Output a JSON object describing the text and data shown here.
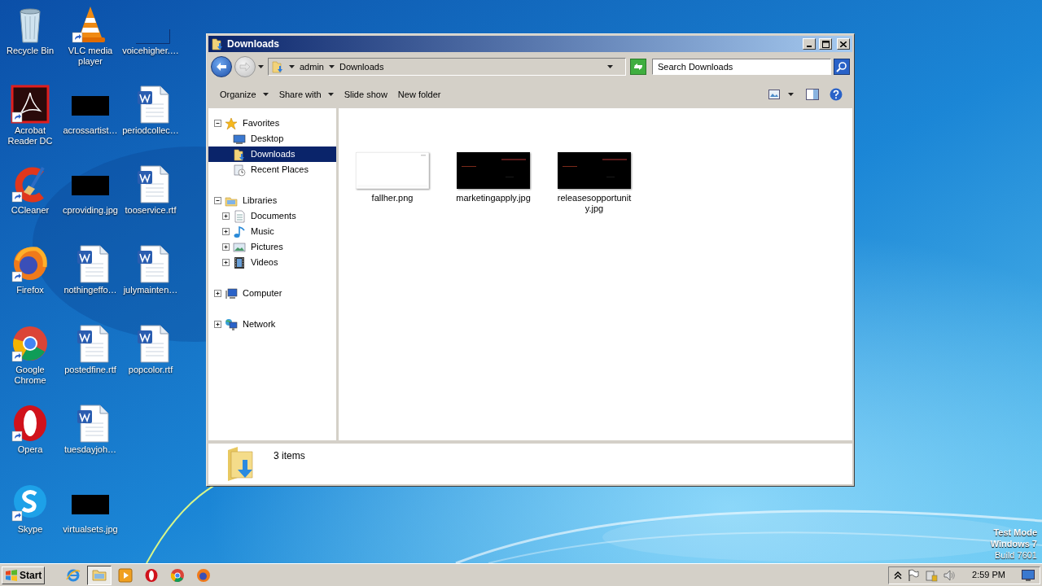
{
  "desktop": {
    "columns": [
      [
        {
          "label": "Recycle Bin",
          "kind": "recycle-bin",
          "shortcut": false
        },
        {
          "label": "Acrobat Reader DC",
          "kind": "acrobat",
          "shortcut": true
        },
        {
          "label": "CCleaner",
          "kind": "ccleaner",
          "shortcut": true
        },
        {
          "label": "Firefox",
          "kind": "firefox",
          "shortcut": true
        },
        {
          "label": "Google Chrome",
          "kind": "chrome",
          "shortcut": true
        },
        {
          "label": "Opera",
          "kind": "opera",
          "shortcut": true
        },
        {
          "label": "Skype",
          "kind": "skype",
          "shortcut": true
        }
      ],
      [
        {
          "label": "VLC media player",
          "kind": "vlc",
          "shortcut": true
        },
        {
          "label": "acrossartist…",
          "shortcut": false
        },
        {
          "label": "cproviding.jpg",
          "shortcut": false
        },
        {
          "label": "nothingeffo…",
          "kind": "word",
          "shortcut": false
        },
        {
          "label": "postedfine.rtf",
          "kind": "word",
          "shortcut": false
        },
        {
          "label": "tuesdayjoh…",
          "kind": "word",
          "shortcut": false
        },
        {
          "label": "virtualsets.jpg",
          "shortcut": false
        }
      ],
      [
        {
          "label": "voicehigher.…",
          "kind": "blank",
          "shortcut": false
        },
        {
          "label": "periodcollec…",
          "kind": "word",
          "shortcut": false
        },
        {
          "label": "tooservice.rtf",
          "kind": "word",
          "shortcut": false
        },
        {
          "label": "julymainten…",
          "kind": "word",
          "shortcut": false
        },
        {
          "label": "popcolor.rtf",
          "kind": "word",
          "shortcut": false
        }
      ]
    ]
  },
  "window": {
    "title": "Downloads",
    "breadcrumb": [
      "admin",
      "Downloads"
    ],
    "search": {
      "placeholder": "Search Downloads"
    },
    "toolbar": [
      {
        "label": "Organize",
        "menu": true
      },
      {
        "label": "Share with",
        "menu": true
      },
      {
        "label": "Slide show",
        "menu": false
      },
      {
        "label": "New folder",
        "menu": false
      }
    ],
    "nav": [
      {
        "label": "Favorites",
        "kind": "star",
        "expanded": true,
        "selected": false,
        "children": [
          {
            "label": "Desktop",
            "kind": "desktop",
            "selected": false
          },
          {
            "label": "Downloads",
            "kind": "downloads",
            "selected": true
          },
          {
            "label": "Recent Places",
            "kind": "recent",
            "selected": false
          }
        ]
      },
      {
        "label": "Libraries",
        "kind": "library",
        "expanded": true,
        "selected": false,
        "children": [
          {
            "label": "Documents",
            "kind": "documents",
            "expanded": false,
            "selected": false
          },
          {
            "label": "Music",
            "kind": "music",
            "expanded": false,
            "selected": false
          },
          {
            "label": "Pictures",
            "kind": "pictures",
            "expanded": false,
            "selected": false
          },
          {
            "label": "Videos",
            "kind": "videos",
            "expanded": false,
            "selected": false
          }
        ]
      },
      {
        "label": "Computer",
        "kind": "computer",
        "expanded": false,
        "selected": false
      },
      {
        "label": "Network",
        "kind": "network",
        "expanded": false,
        "selected": false
      }
    ],
    "files": [
      {
        "name": "fallher.png",
        "kind": "light"
      },
      {
        "name": "marketingapply.jpg",
        "kind": "dark"
      },
      {
        "name": "releasesopportunity.jpg",
        "kind": "dark"
      }
    ],
    "details": {
      "count": "3 items"
    }
  },
  "watermark_os": {
    "line_1": "Test Mode",
    "line_2": "Windows 7",
    "line_3": "Build 7601"
  },
  "taskbar": {
    "start": "Start",
    "apps": [
      {
        "kind": "ie",
        "active": false
      },
      {
        "kind": "explorer",
        "active": true
      },
      {
        "kind": "media",
        "active": false
      },
      {
        "kind": "opera",
        "active": false
      },
      {
        "kind": "chrome",
        "active": false
      },
      {
        "kind": "firefox",
        "active": false
      }
    ],
    "clock": "2:59 PM"
  }
}
